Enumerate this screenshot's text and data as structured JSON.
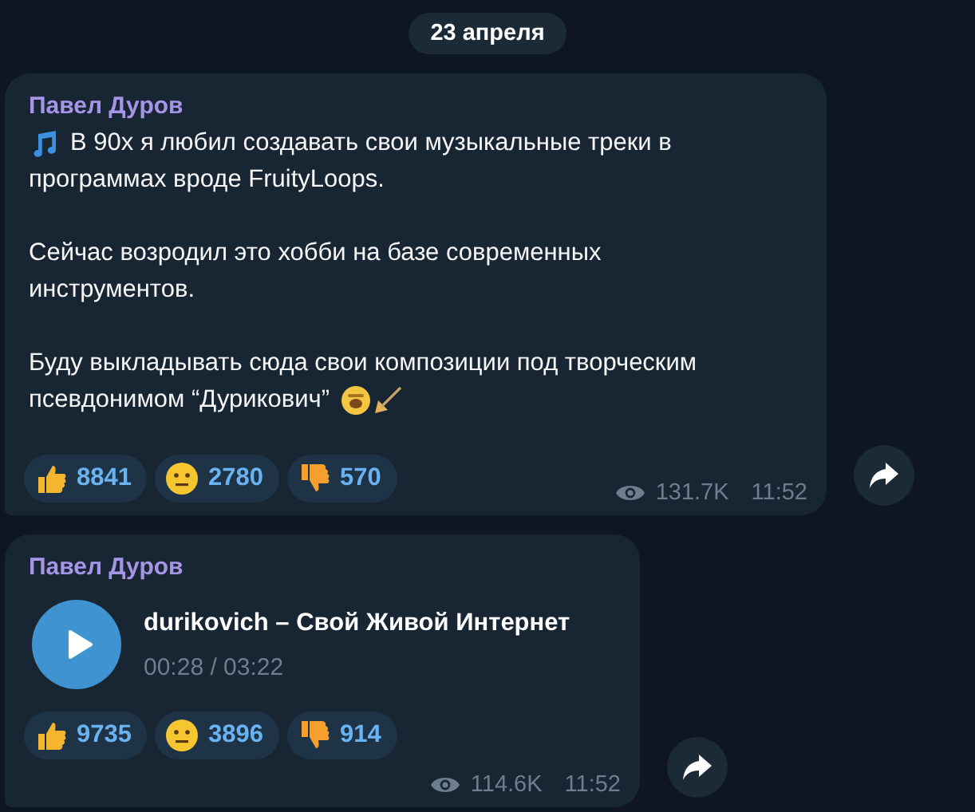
{
  "date_badge": "23 апреля",
  "messages": [
    {
      "kind": "text",
      "author": "Павел Дуров",
      "paragraphs": [
        [
          "В 90х я любил создавать свои музыкальные треки в",
          "программах вроде FruityLoops."
        ],
        [
          "Сейчас возродил это хобби на базе современных",
          "инструментов."
        ],
        [
          "Буду выкладывать сюда свои композиции под творческим",
          "псевдонимом “Дурикович”"
        ]
      ],
      "reactions": [
        {
          "kind": "thumbs_up",
          "count": "8841"
        },
        {
          "kind": "neutral",
          "count": "2780"
        },
        {
          "kind": "thumbs_down",
          "count": "570"
        }
      ],
      "views": "131.7K",
      "time": "11:52"
    },
    {
      "kind": "audio",
      "author": "Павел Дуров",
      "track": {
        "title": "durikovich – Свой Живой Интернет",
        "progress": "00:28 / 03:22"
      },
      "reactions": [
        {
          "kind": "thumbs_up",
          "count": "9735"
        },
        {
          "kind": "neutral",
          "count": "3896"
        },
        {
          "kind": "thumbs_down",
          "count": "914"
        }
      ],
      "views": "114.6K",
      "time": "11:52"
    }
  ]
}
